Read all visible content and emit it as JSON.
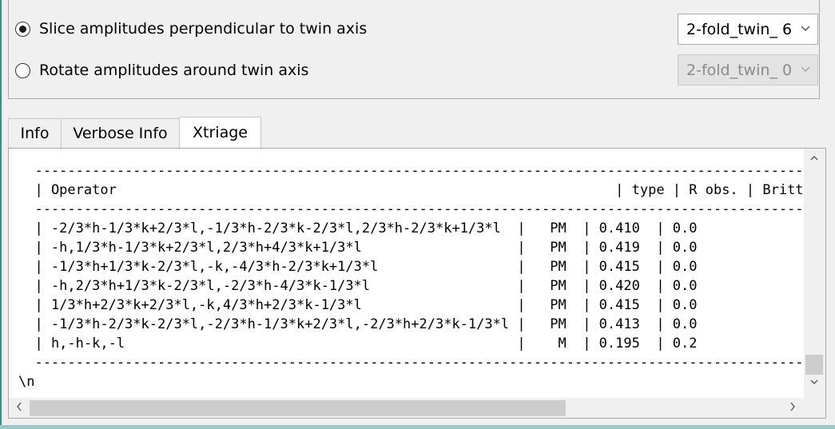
{
  "twin_options": {
    "slice": {
      "label": "Slice amplitudes perpendicular to twin axis",
      "checked": true,
      "combo_value": "2-fold_twin_ 6"
    },
    "rotate": {
      "label": "Rotate amplitudes around twin axis",
      "checked": false,
      "combo_value": "2-fold_twin_ 0"
    }
  },
  "tabs": [
    {
      "label": "Info",
      "active": false
    },
    {
      "label": "Verbose Info",
      "active": false
    },
    {
      "label": "Xtriage",
      "active": true
    }
  ],
  "xtriage_text": {
    "lines": [
      "  -----------------------------------------------------------------------------------------------------------",
      "  | Operator                                                             | type | R obs. | Britton alpha |",
      "  -----------------------------------------------------------------------------------------------------------",
      "  | -2/3*h-1/3*k+2/3*l,-1/3*h-2/3*k-2/3*l,2/3*h-2/3*k+1/3*l  |   PM  | 0.410  | 0.0",
      "  | -h,1/3*h-1/3*k+2/3*l,2/3*h+4/3*k+1/3*l                   |   PM  | 0.419  | 0.0",
      "  | -1/3*h+1/3*k-2/3*l,-k,-4/3*h-2/3*k+1/3*l                 |   PM  | 0.415  | 0.0",
      "  | -h,2/3*h+1/3*k-2/3*l,-2/3*h-4/3*k-1/3*l                  |   PM  | 0.420  | 0.0",
      "  | 1/3*h+2/3*k+2/3*l,-k,4/3*h+2/3*k-1/3*l                   |   PM  | 0.415  | 0.0",
      "  | -1/3*h-2/3*k-2/3*l,-2/3*h-1/3*k+2/3*l,-2/3*h+2/3*k-1/3*l |   PM  | 0.413  | 0.0",
      "  | h,-h-k,-l                                                |    M  | 0.195  | 0.2",
      "  -----------------------------------------------------------------------------------------------------------",
      "\\n"
    ]
  },
  "icons": {
    "combo_arrow": "chevron-down-icon",
    "scroll_up": "triangle-up-icon",
    "scroll_down": "triangle-down-icon",
    "scroll_left": "triangle-left-icon",
    "scroll_right": "triangle-right-icon"
  },
  "colors": {
    "window_bg": "#f0f0f0",
    "pane_bg": "#ffffff",
    "disabled_text": "#8a8a8a",
    "frame_accent": "#3c8e8e"
  }
}
